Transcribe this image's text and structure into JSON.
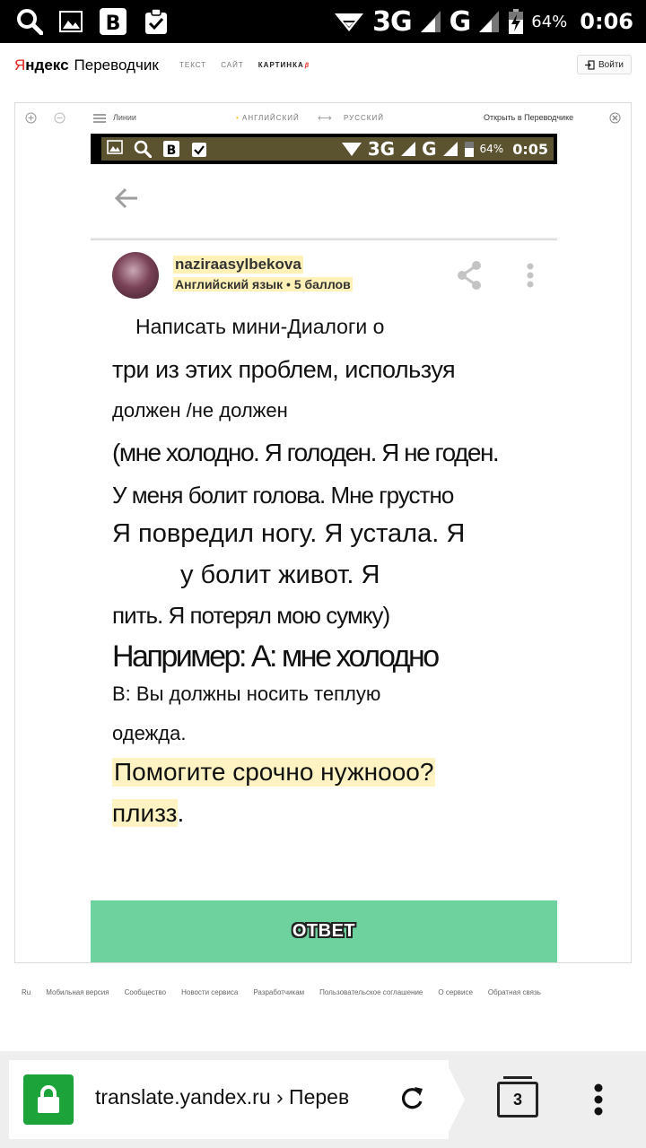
{
  "status_bar": {
    "network_3g": "3G",
    "network_g": "G",
    "battery": "64%",
    "time": "0:06",
    "left_icons": [
      "search-icon",
      "image-icon",
      "vk-icon",
      "clipboard-check-icon"
    ]
  },
  "header": {
    "logo_letter": "Я",
    "logo_rest": "ндекс",
    "service": "Переводчик",
    "tabs": [
      {
        "label": "ТЕКСТ"
      },
      {
        "label": "САЙТ"
      },
      {
        "label": "КАРТИНКА",
        "beta": "β"
      }
    ],
    "login": "Войти"
  },
  "viewer": {
    "lines_label": "Линии",
    "source_lang": "АНГЛИЙСКИЙ",
    "target_lang": "РУССКИЙ",
    "open_in": "Открыть в Переводчике",
    "source_lang_dot": "•",
    "swap": "⟷"
  },
  "screenshot": {
    "status": {
      "network_3g": "3G",
      "network_g": "G",
      "battery": "64%",
      "time": "0:05"
    },
    "user": {
      "name": "naziraasylbekova",
      "subject": "Английский язык • 5 баллов"
    },
    "question_lines": [
      "Написать мини-Диалоги о",
      "три из этих проблем, используя",
      "должен /не должен",
      "(мне холодно. Я голоден. Я не годен.",
      "У меня болит голова. Мне грустно",
      "Я повредил ногу. Я устала. Я",
      "у болит живот. Я",
      "пить. Я потерял мою сумку)",
      "Например: А: мне холодно",
      "В: Вы должны носить теплую",
      "одежда."
    ],
    "request_line1": "Помогите срочно нужнооо?",
    "request_line2_hl": "плизз",
    "request_line2_end": ".",
    "answer_button": "ОТВЕТ"
  },
  "footer": {
    "links": [
      "Ru",
      "Мобильная версия",
      "Сообщество",
      "Новости сервиса",
      "Разработчикам",
      "Пользовательское соглашение",
      "О сервисе",
      "Обратная связь"
    ]
  },
  "browser": {
    "url": "translate.yandex.ru › Перев",
    "tab_count": "3"
  }
}
